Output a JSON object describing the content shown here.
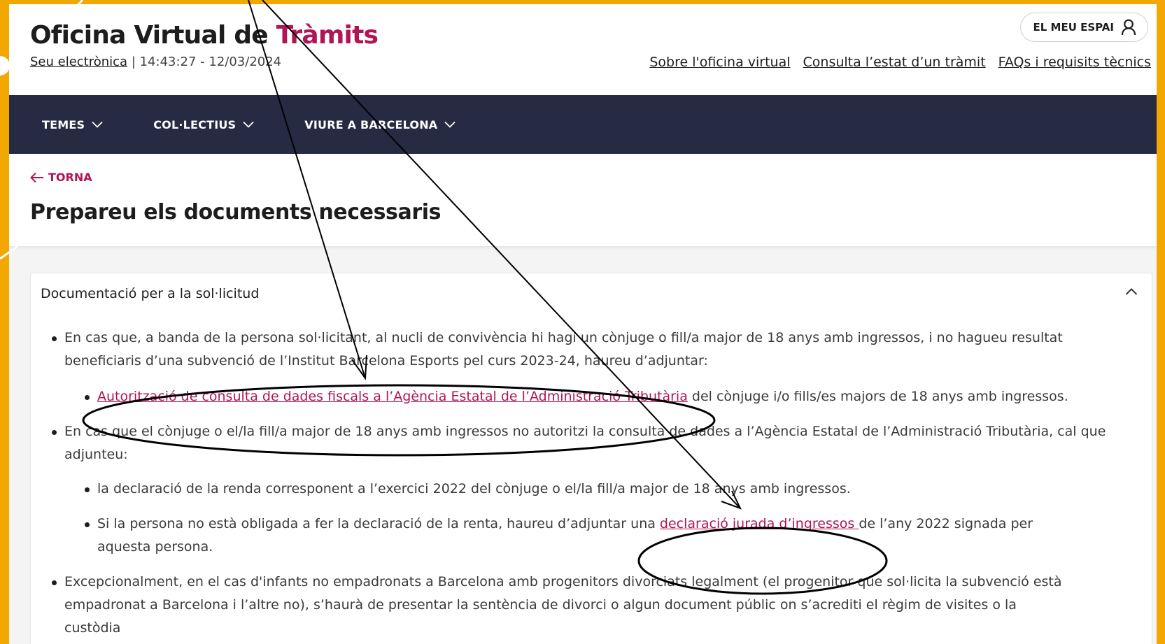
{
  "colors": {
    "frame": "#f2a800",
    "accent": "#b01556",
    "nav_bg": "#262a42",
    "annotation": "#000000"
  },
  "header": {
    "title_main": "Oficina Virtual de ",
    "title_accent": "Tràmits",
    "seu_link": "Seu electrònica",
    "datetime": " | 14:43:27 - 12/03/2024",
    "account_button": "EL MEU ESPAI",
    "account_icon": "user-icon",
    "links": [
      "Sobre l'oficina virtual",
      "Consulta l’estat d’un tràmit",
      "FAQs i requisits tècnics"
    ]
  },
  "nav": {
    "items": [
      "TEMES",
      "COL·LECTIUS",
      "VIURE A BARCELONA"
    ],
    "item_icon": "chevron-down-icon"
  },
  "subheader": {
    "back_icon": "arrow-left-icon",
    "back_label": "TORNA",
    "title": "Prepareu els documents necessaris"
  },
  "section": {
    "title": "Documentació per a la sol·licitud",
    "toggle_icon": "chevron-up-icon",
    "items": [
      {
        "text": "En cas que, a banda de la persona sol·licitant, al nucli de convivència hi hagi un cònjuge o fill/a major de 18 anys amb ingressos, i no hagueu resultat beneficiaris d’una subvenció de l’Institut Barcelona Esports pel curs 2023-24, haureu d’adjuntar:",
        "sub": {
          "link": "Autorització de consulta de dades fiscals a l’Agència Estatal de l’Administració Tributària",
          "after": " del cònjuge i/o fills/es majors de 18 anys amb ingressos."
        }
      },
      {
        "text": "En cas que el cònjuge o el/la fill/a major de 18 anys amb ingressos no autoritzi la consulta de dades a l’Agència Estatal de l’Administració Tributària, cal que adjunteu:",
        "sub1": "la declaració de la renda corresponent a l’exercici 2022 del cònjuge o el/la fill/a major de 18 anys amb ingressos.",
        "sub2": {
          "before": "Si la persona no està obligada a fer la declaració de la renta, haureu d’adjuntar una ",
          "link": "declaració jurada d’ingressos ",
          "after": "de l’any 2022 signada per aquesta persona."
        }
      },
      {
        "text": "Excepcionalment, en el cas d'infants no empadronats a Barcelona amb progenitors divorciats legalment (el progenitor que sol·licita la subvenció està empadronat a Barcelona i l’altre no), s’haurà de presentar la sentència de divorci o algun document públic on s’acrediti el règim de visites o la custòdia"
      }
    ]
  }
}
